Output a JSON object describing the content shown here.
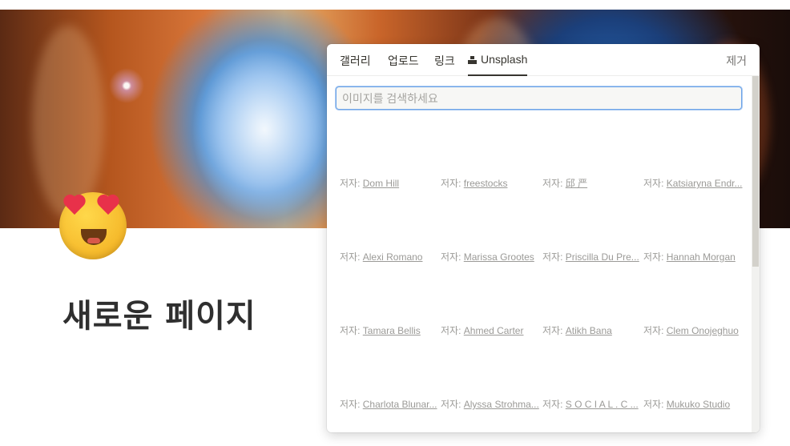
{
  "page": {
    "title": "새로운 페이지"
  },
  "picker": {
    "tabs": [
      {
        "label": "갤러리"
      },
      {
        "label": "업로드"
      },
      {
        "label": "링크"
      },
      {
        "label": "Unsplash"
      }
    ],
    "active_tab": "Unsplash",
    "remove_label": "제거",
    "search": {
      "value": "",
      "placeholder": "이미지를 검색하세요"
    },
    "credit_prefix": "저자:",
    "credits": [
      [
        "Dom Hill",
        "freestocks",
        "邱 严",
        "Katsiaryna Endr..."
      ],
      [
        "Alexi Romano",
        "Marissa Grootes",
        "Priscilla Du Pre...",
        "Hannah Morgan"
      ],
      [
        "Tamara Bellis",
        "Ahmed Carter",
        "Atikh Bana",
        "Clem Onojeghuo"
      ],
      [
        "Charlota Blunar...",
        "Alyssa Strohma...",
        "S O C I A L . C ...",
        "Mukuko Studio"
      ]
    ]
  },
  "icons": {
    "page_icon": "smiling-face-with-heart-eyes-icon",
    "unsplash_tab_icon": "unsplash-logo-icon"
  },
  "colors": {
    "search_focus_border": "#6fa5e8",
    "tab_active_underline": "#37352f",
    "credit_text": "#9b9a97"
  }
}
